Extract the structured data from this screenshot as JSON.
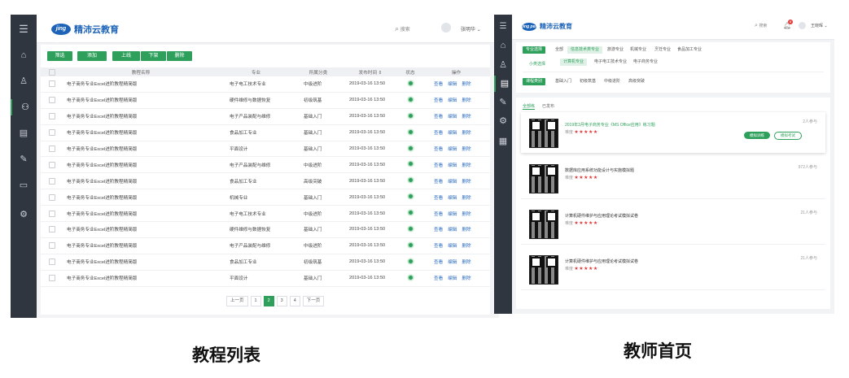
{
  "left": {
    "logo_mark": "jing pei",
    "logo_name": "精沛云教育",
    "search_label": "搜索",
    "user_name": "张明华",
    "toolbar": [
      "筛选",
      "添加",
      "上线",
      "下架",
      "删除"
    ],
    "columns": [
      "教程名称",
      "专业",
      "所属分类",
      "发布时间",
      "状态",
      "操作"
    ],
    "rows": [
      {
        "name": "电子商务专业Excel进阶教程精简版",
        "major": "电子电工技术专业",
        "cat": "中级进阶",
        "date": "2019-03-16 13:50"
      },
      {
        "name": "电子商务专业Excel进阶教程精简版",
        "major": "硬件维修与数据恢复",
        "cat": "初级筑基",
        "date": "2019-03-16 13:50"
      },
      {
        "name": "电子商务专业Excel进阶教程精简版",
        "major": "电子产品装配与维修",
        "cat": "基础入门",
        "date": "2019-03-16 13:50"
      },
      {
        "name": "电子商务专业Excel进阶教程精简版",
        "major": "食品加工专业",
        "cat": "基础入门",
        "date": "2019-03-16 13:50"
      },
      {
        "name": "电子商务专业Excel进阶教程精简版",
        "major": "平面设计",
        "cat": "基础入门",
        "date": "2019-03-16 13:50"
      },
      {
        "name": "电子商务专业Excel进阶教程精简版",
        "major": "电子产品装配与维修",
        "cat": "中级进阶",
        "date": "2019-03-16 13:50"
      },
      {
        "name": "电子商务专业Excel进阶教程精简版",
        "major": "食品加工专业",
        "cat": "高级突破",
        "date": "2019-03-16 13:50"
      },
      {
        "name": "电子商务专业Excel进阶教程精简版",
        "major": "机械专业",
        "cat": "基础入门",
        "date": "2019-03-16 13:50"
      },
      {
        "name": "电子商务专业Excel进阶教程精简版",
        "major": "电子电工技术专业",
        "cat": "中级进阶",
        "date": "2019-03-16 13:50"
      },
      {
        "name": "电子商务专业Excel进阶教程精简版",
        "major": "硬件维修与数据恢复",
        "cat": "基础入门",
        "date": "2019-03-16 13:50"
      },
      {
        "name": "电子商务专业Excel进阶教程精简版",
        "major": "电子产品装配与维修",
        "cat": "中级进阶",
        "date": "2019-03-16 13:50"
      },
      {
        "name": "电子商务专业Excel进阶教程精简版",
        "major": "食品加工专业",
        "cat": "初级筑基",
        "date": "2019-03-16 13:50"
      },
      {
        "name": "电子商务专业Excel进阶教程精简版",
        "major": "平面设计",
        "cat": "基础入门",
        "date": "2019-03-16 13:50"
      }
    ],
    "ops": [
      "查看",
      "编辑",
      "删除"
    ],
    "pager": [
      "上一页",
      "1",
      "2",
      "3",
      "4",
      "下一页"
    ],
    "caption": "教程列表"
  },
  "right": {
    "logo_name": "精沛云教育",
    "search_label": "搜索",
    "user_name": "王晓晖",
    "notif_count": "8",
    "major_label": "专业选择",
    "majors": [
      "全部",
      "信息技术类专业",
      "旅游专业",
      "机械专业",
      "烹饪专业",
      "食品加工专业"
    ],
    "sub_label": "小类选择",
    "subs": [
      "计算机专业",
      "电子电工技术专业",
      "电子商务专业"
    ],
    "cat_label": "课程类别",
    "cats": [
      "基础入门",
      "初级筑基",
      "中级进阶",
      "高级突破"
    ],
    "tabs": [
      "全部练",
      "已发布"
    ],
    "items": [
      {
        "title": "2019年3月电子商务专业《MS Office应用》练习题",
        "meta": "难度",
        "count": "2人参与",
        "btn1": "模拟训练",
        "btn2": "模拟考试"
      },
      {
        "title": "数据库应用系统功能设计与实施模拟题",
        "meta": "难度",
        "count": "972人参与"
      },
      {
        "title": "计算机硬件维护与应用理论考试模拟试卷",
        "meta": "难度",
        "count": "21人参与"
      },
      {
        "title": "计算机硬件维护与应用理论考试模拟试卷",
        "meta": "难度",
        "count": "21人参与"
      }
    ],
    "stars": "★★★★★",
    "caption": "教师首页"
  },
  "colors": {
    "accent": "#2ea05c",
    "sidebar": "#303640",
    "link": "#2e6ebf"
  }
}
